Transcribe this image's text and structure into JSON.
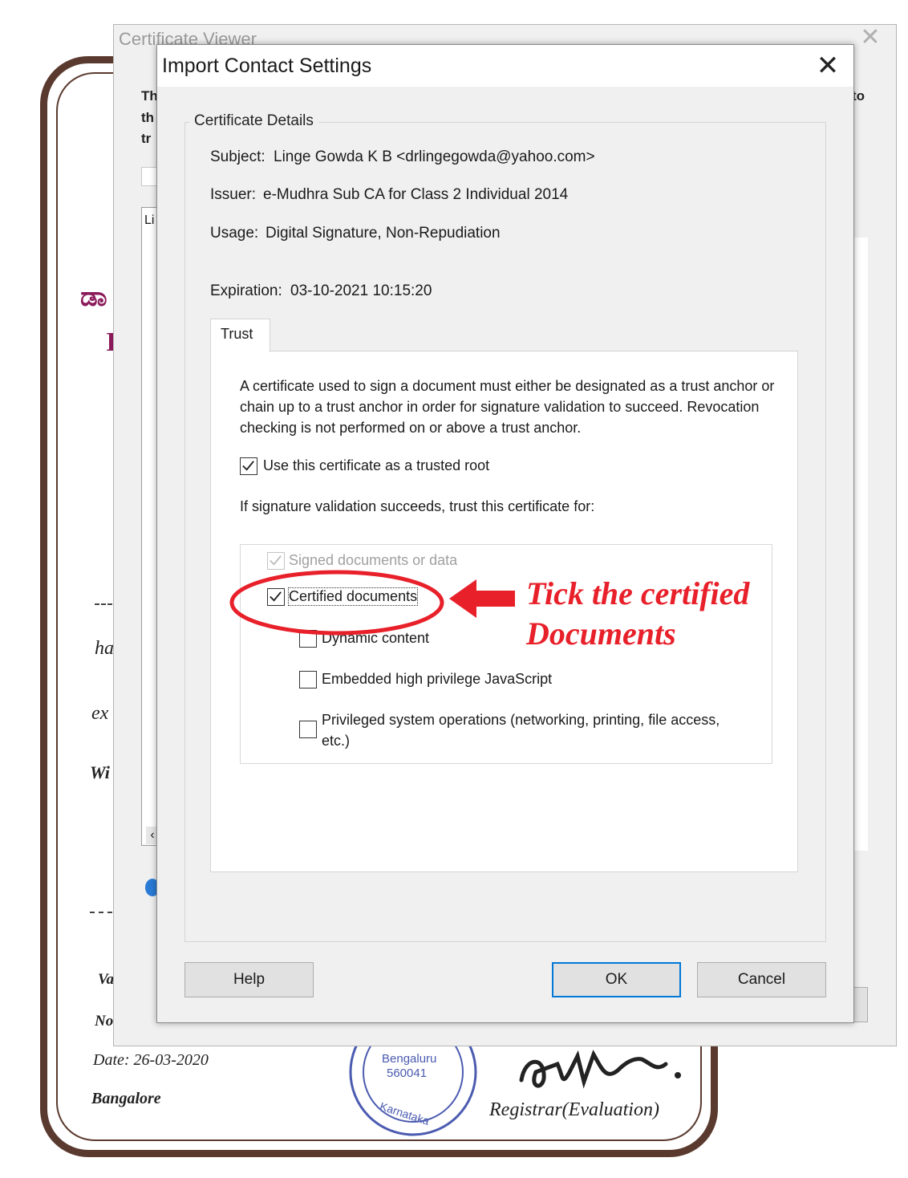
{
  "background_document": {
    "kannada_fragment": "ಡಾ",
    "line_fragment": "I",
    "text_fragments": [
      "ha",
      "ex",
      "Wi",
      "Va",
      "No"
    ],
    "date": "Date: 26-03-2020",
    "place": "Bangalore",
    "seal_text": [
      "Bengaluru",
      "560041",
      "Karnataka"
    ],
    "signature_title": "Registrar(Evaluation)"
  },
  "certificate_viewer": {
    "title": "Certificate Viewer",
    "close_glyph": "✕",
    "left_fragments": [
      "Th",
      "th",
      "tr"
    ],
    "right_fragment": "to",
    "list_fragment": "Li"
  },
  "dialog": {
    "title": "Import Contact Settings",
    "close_glyph": "✕",
    "details_legend": "Certificate Details",
    "subject_label": "Subject:",
    "subject_value": "Linge Gowda K B <drlingegowda@yahoo.com>",
    "issuer_label": "Issuer:",
    "issuer_value": "e-Mudhra Sub CA for Class 2 Individual 2014",
    "usage_label": "Usage:",
    "usage_value": "Digital Signature, Non-Repudiation",
    "expiration_label": "Expiration:",
    "expiration_value": "03-10-2021 10:15:20",
    "tab_trust": "Trust",
    "trust_description": "A certificate used to sign a document must either be designated as a trust anchor or chain up to a trust anchor in order for signature validation to succeed.  Revocation checking is not performed on or above a trust anchor.",
    "use_trusted_root": {
      "label": "Use this certificate as a trusted root",
      "checked": true
    },
    "trust_for_label": "If signature validation succeeds, trust this certificate for:",
    "signed_documents": {
      "label": "Signed documents or data",
      "checked": true,
      "disabled": true
    },
    "certified_documents": {
      "label": "Certified documents",
      "checked": true
    },
    "dynamic_content": {
      "label": "Dynamic content",
      "checked": false
    },
    "embedded_js": {
      "label": "Embedded high privilege JavaScript",
      "checked": false
    },
    "privileged_ops": {
      "label_line1": "Privileged system operations (networking, printing, file access,",
      "label_line2": "etc.)",
      "checked": false
    },
    "buttons": {
      "help": "Help",
      "ok": "OK",
      "cancel": "Cancel"
    }
  },
  "annotation": {
    "line1": "Tick the certified",
    "line2": "Documents",
    "color": "#e8202a"
  }
}
